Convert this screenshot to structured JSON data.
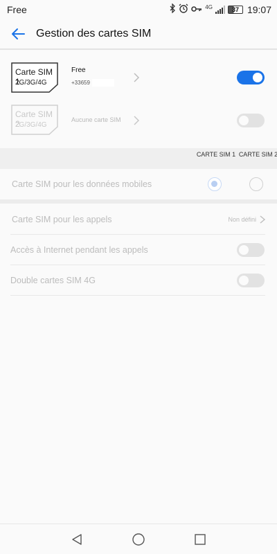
{
  "status_bar": {
    "carrier": "Free",
    "network": "4G",
    "battery": "37",
    "time": "19:07"
  },
  "header": {
    "title": "Gestion des cartes SIM"
  },
  "sims": [
    {
      "name": "Carte SIM 1",
      "type": "2G/3G/4G",
      "carrier": "Free",
      "number": "+33659",
      "enabled": true
    },
    {
      "name": "Carte SIM 2",
      "type": "2G/3G/4G",
      "status": "Aucune carte SIM",
      "enabled": false
    }
  ],
  "columns": {
    "sim1": "CARTE SIM 1",
    "sim2": "CARTE SIM 2"
  },
  "settings": {
    "mobile_data_label": "Carte SIM pour les données mobiles",
    "calls_label": "Carte SIM pour les appels",
    "calls_value": "Non défini",
    "internet_during_calls_label": "Accès à Internet pendant les appels",
    "dual_4g_label": "Double cartes SIM 4G"
  },
  "colors": {
    "accent": "#1a73e8",
    "disabled_text": "#bcbcbc"
  },
  "icons": {
    "back": "arrow-back-icon",
    "bluetooth": "bluetooth-icon",
    "alarm": "alarm-icon",
    "key": "key-icon",
    "signal": "signal-icon",
    "battery": "battery-icon",
    "nav_back": "nav-back-icon",
    "nav_home": "nav-home-icon",
    "nav_recents": "nav-recents-icon"
  }
}
